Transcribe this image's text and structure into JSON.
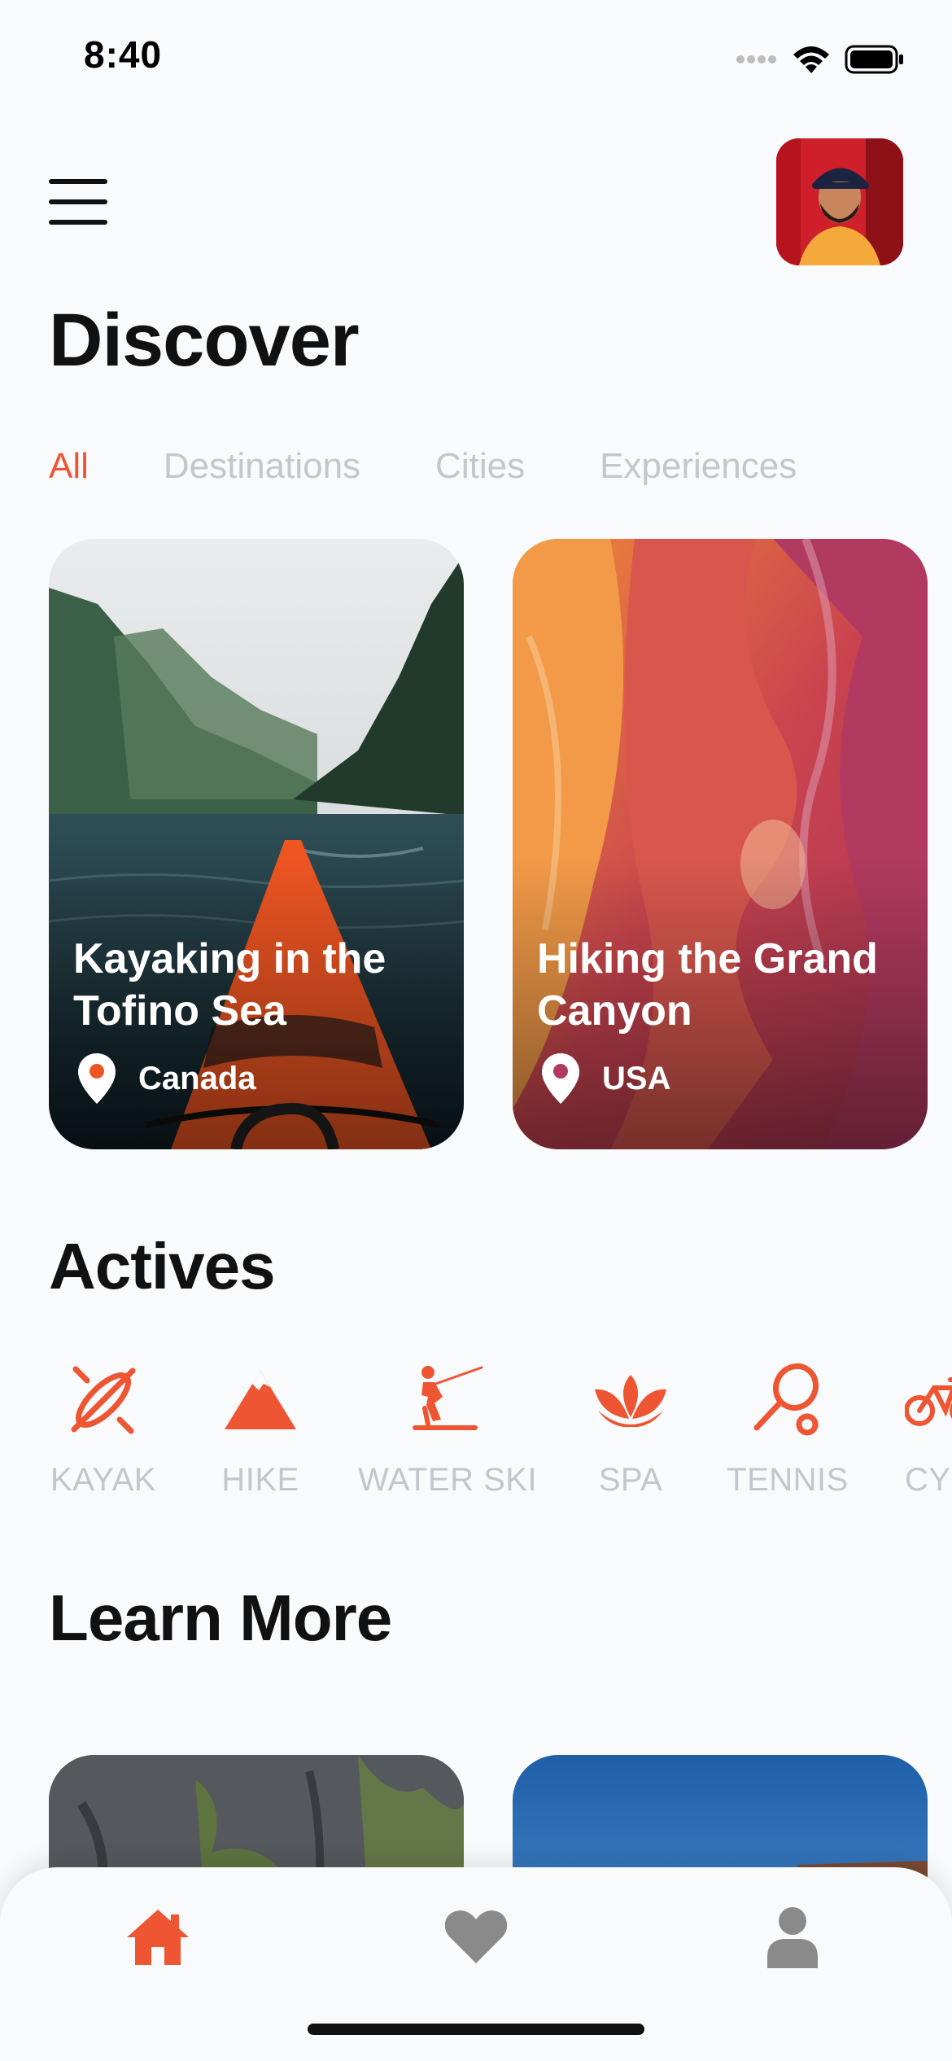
{
  "status_bar": {
    "time": "8:40"
  },
  "header": {
    "title": "Discover"
  },
  "tabs": [
    {
      "label": "All",
      "active": true
    },
    {
      "label": "Destinations",
      "active": false
    },
    {
      "label": "Cities",
      "active": false
    },
    {
      "label": "Experiences",
      "active": false
    }
  ],
  "cards": [
    {
      "title": "Kayaking in the Tofino Sea",
      "location": "Canada"
    },
    {
      "title": "Hiking the Grand Canyon",
      "location": "USA"
    }
  ],
  "sections": {
    "actives": "Actives",
    "learn_more": "Learn More"
  },
  "activities": [
    {
      "label": "KAYAK",
      "icon": "kayak-icon"
    },
    {
      "label": "HIKE",
      "icon": "mountain-icon"
    },
    {
      "label": "WATER SKI",
      "icon": "water-ski-icon"
    },
    {
      "label": "SPA",
      "icon": "lotus-icon"
    },
    {
      "label": "TENNIS",
      "icon": "tennis-racket-icon"
    },
    {
      "label": "CY",
      "icon": "bicycle-icon"
    }
  ],
  "bottom_nav": [
    {
      "icon": "home-icon",
      "active": true
    },
    {
      "icon": "heart-icon",
      "active": false
    },
    {
      "icon": "user-icon",
      "active": false
    }
  ],
  "colors": {
    "accent": "#ee5533",
    "inactive": "#c4c6cc",
    "background": "#f9fafc"
  }
}
